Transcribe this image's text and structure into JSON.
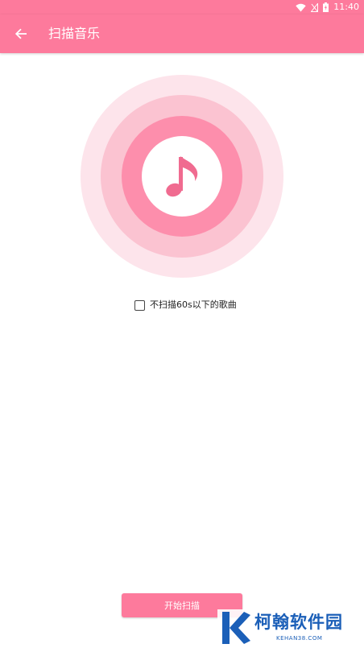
{
  "status_bar": {
    "time": "11:40",
    "icons": [
      "wifi-icon",
      "signal-off-icon",
      "battery-icon"
    ]
  },
  "app_bar": {
    "title": "扫描音乐",
    "back_icon": "arrow-left-icon",
    "background_color": "#fd7a9c"
  },
  "illustration": {
    "icon": "music-note-icon",
    "ring_colors": [
      "#fde4eb",
      "#fbc3d1",
      "#fd8eac",
      "#ffffff"
    ],
    "note_color": "#f06b90"
  },
  "options": {
    "skip_short_label": "不扫描60s以下的歌曲",
    "skip_short_checked": false
  },
  "actions": {
    "start_scan_label": "开始扫描"
  },
  "watermark": {
    "name": "柯翰软件园",
    "url": "KEHAN38.COM"
  }
}
